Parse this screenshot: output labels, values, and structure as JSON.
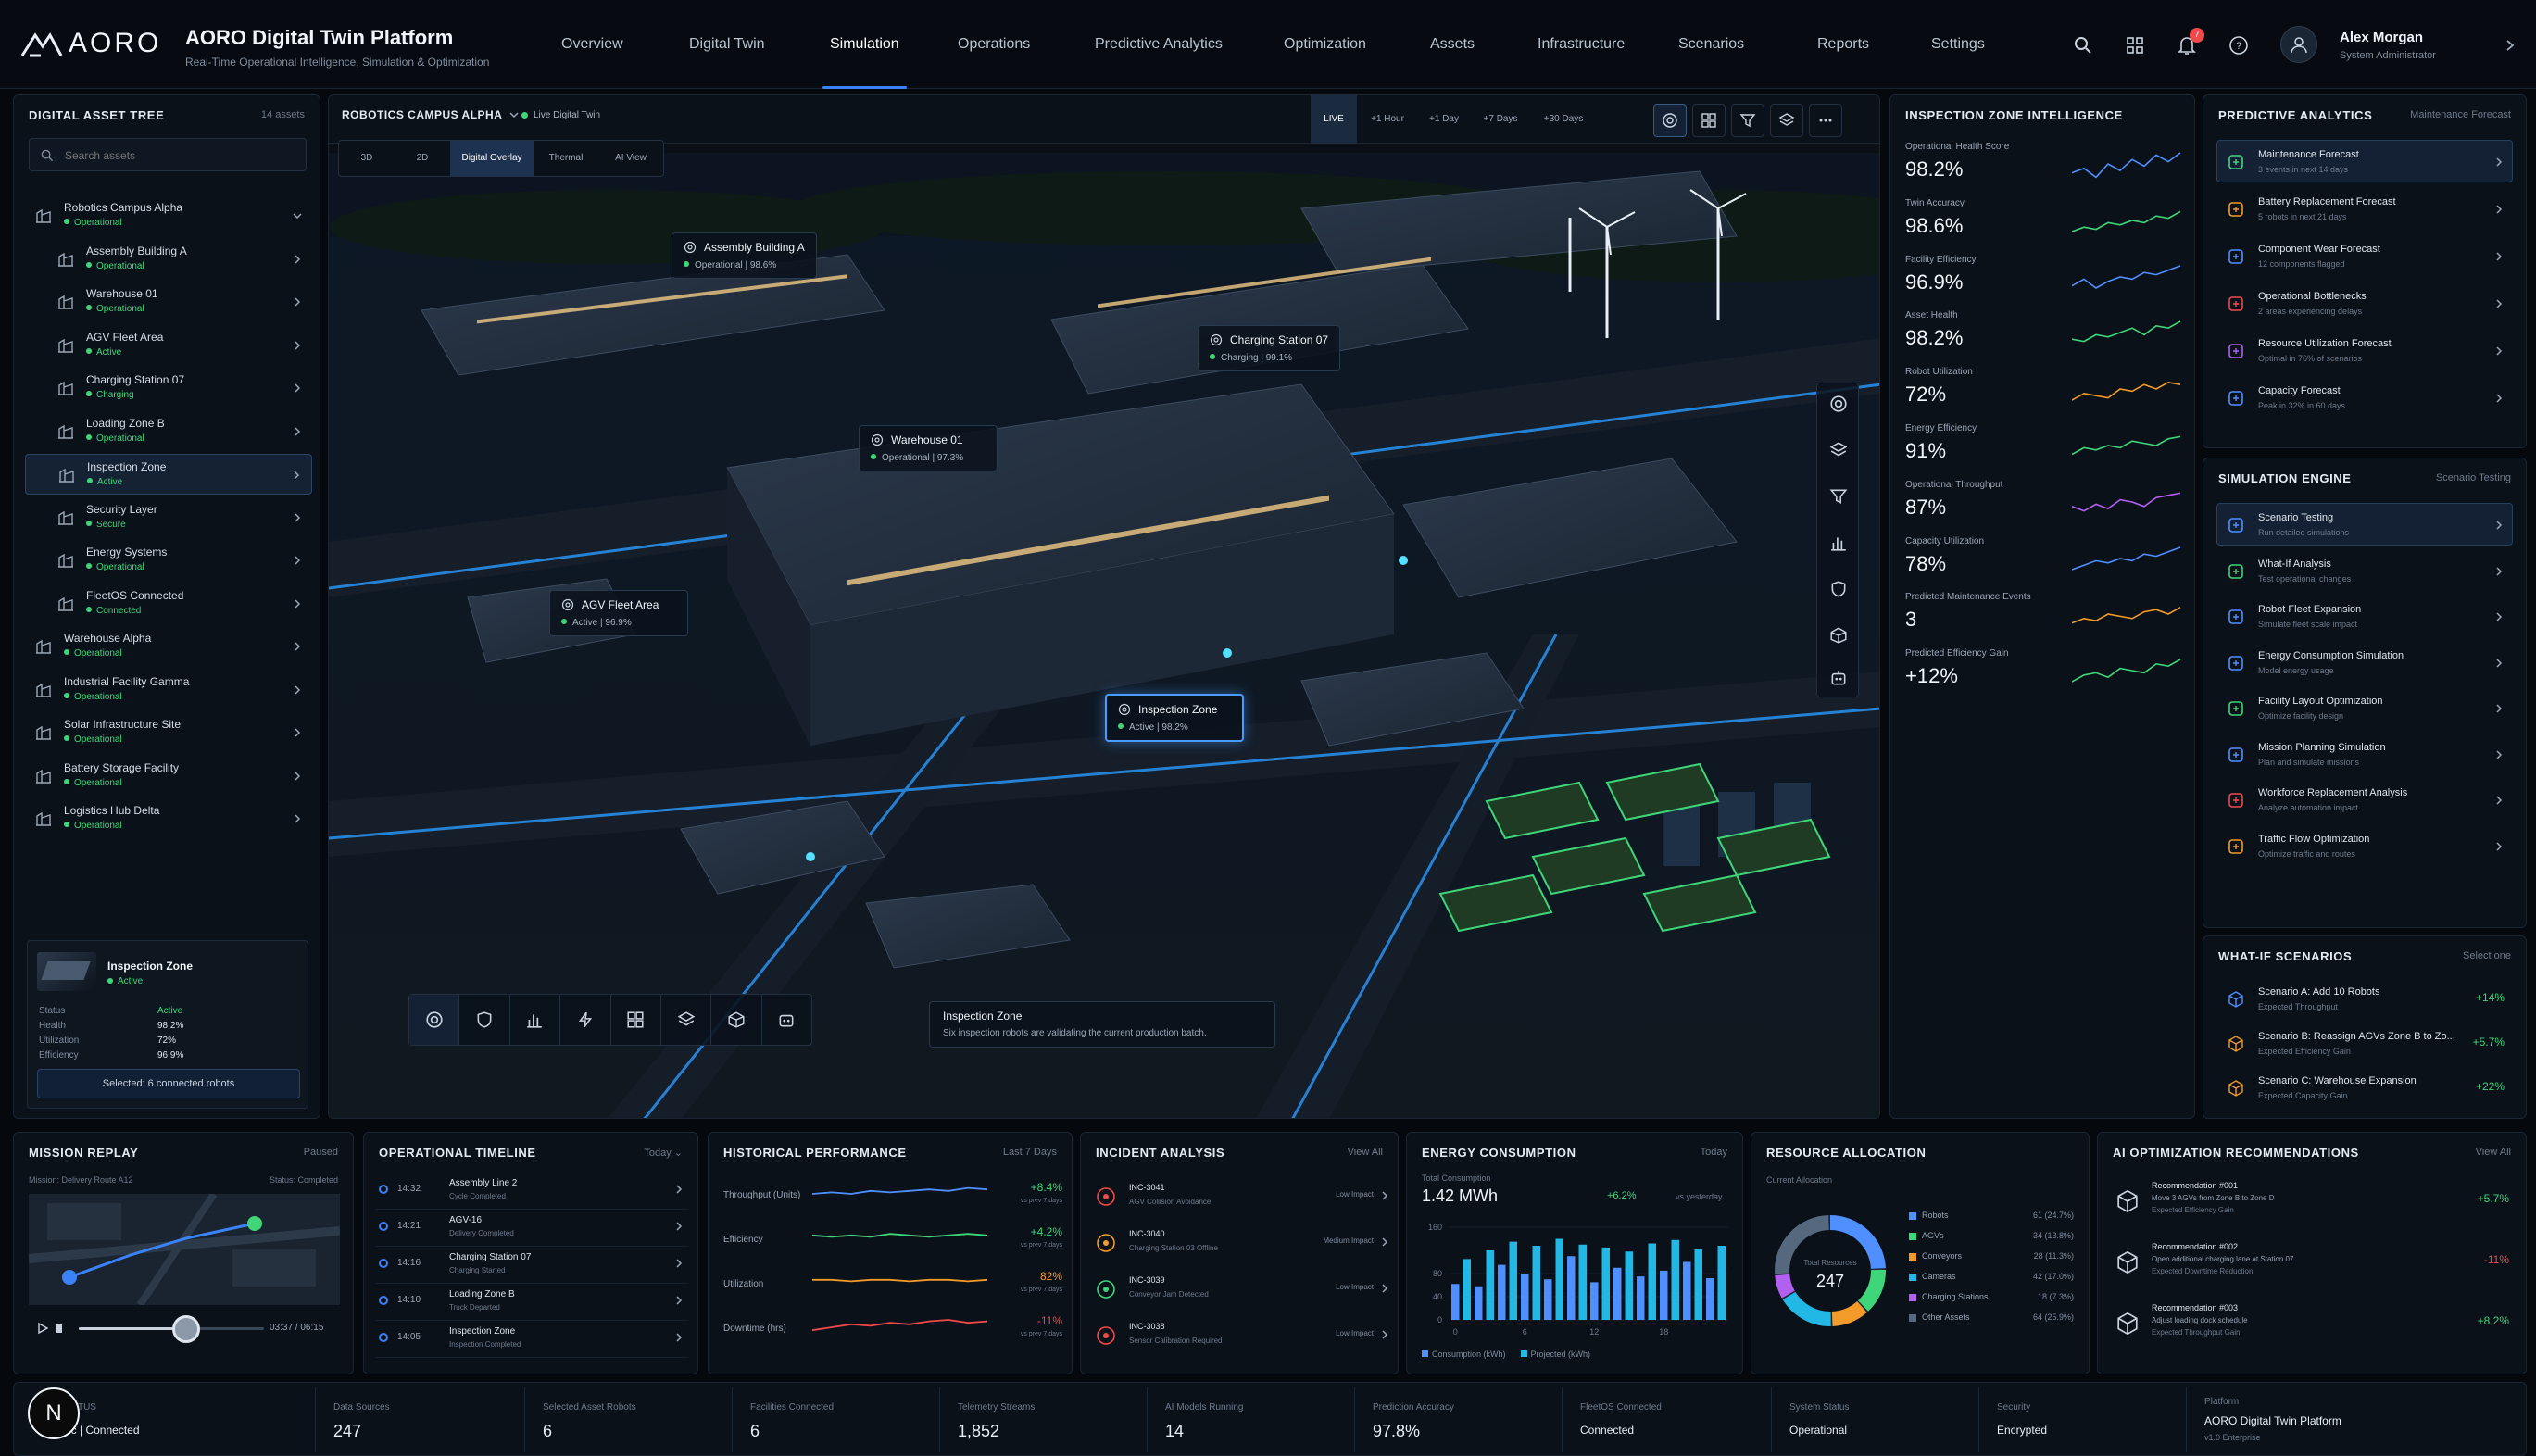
{
  "brand": {
    "logo_text": "AORO",
    "title": "AORO Digital Twin Platform",
    "subtitle": "Real-Time Operational Intelligence, Simulation & Optimization"
  },
  "nav": [
    "Overview",
    "Digital Twin",
    "Simulation",
    "Operations",
    "Predictive Analytics",
    "Optimization",
    "Assets",
    "Infrastructure",
    "Scenarios",
    "Reports",
    "Settings"
  ],
  "nav_active": "Simulation",
  "notif_count": "7",
  "user": {
    "name": "Alex Morgan",
    "role": "System Administrator"
  },
  "tree": {
    "title": "DIGITAL ASSET TREE",
    "count": "14 assets",
    "search_placeholder": "Search assets",
    "items": [
      {
        "name": "Robotics Campus Alpha",
        "status": "Operational",
        "level": 0,
        "open": true
      },
      {
        "name": "Assembly Building A",
        "status": "Operational",
        "level": 1
      },
      {
        "name": "Warehouse 01",
        "status": "Operational",
        "level": 1
      },
      {
        "name": "AGV Fleet Area",
        "status": "Active",
        "level": 1
      },
      {
        "name": "Charging Station 07",
        "status": "Charging",
        "level": 1
      },
      {
        "name": "Loading Zone B",
        "status": "Operational",
        "level": 1
      },
      {
        "name": "Inspection Zone",
        "status": "Active",
        "level": 1,
        "selected": true
      },
      {
        "name": "Security Layer",
        "status": "Secure",
        "level": 1
      },
      {
        "name": "Energy Systems",
        "status": "Operational",
        "level": 1
      },
      {
        "name": "FleetOS Connected",
        "status": "Connected",
        "level": 1
      },
      {
        "name": "Warehouse Alpha",
        "status": "Operational",
        "level": 0
      },
      {
        "name": "Industrial Facility Gamma",
        "status": "Operational",
        "level": 0
      },
      {
        "name": "Solar Infrastructure Site",
        "status": "Operational",
        "level": 0
      },
      {
        "name": "Battery Storage Facility",
        "status": "Operational",
        "level": 0
      },
      {
        "name": "Logistics Hub Delta",
        "status": "Operational",
        "level": 0
      }
    ],
    "detail": {
      "name": "Inspection Zone",
      "status": "Active",
      "rows": [
        [
          "Status",
          "Active"
        ],
        [
          "Health",
          "98.2%"
        ],
        [
          "Utilization",
          "72%"
        ],
        [
          "Efficiency",
          "96.9%"
        ]
      ],
      "button": "Selected: 6 connected robots"
    }
  },
  "scene": {
    "location": "ROBOTICS CAMPUS ALPHA",
    "live_label": "Live Digital Twin",
    "time_buttons": [
      "LIVE",
      "+1 Hour",
      "+1 Day",
      "+7 Days",
      "+30 Days"
    ],
    "view_tabs": [
      "3D",
      "2D",
      "Digital Overlay",
      "Thermal",
      "AI View"
    ],
    "view_active": "Digital Overlay",
    "tags": [
      {
        "name": "Assembly Building A",
        "info": "Operational | 98.6%"
      },
      {
        "name": "Charging Station 07",
        "info": "Charging | 99.1%"
      },
      {
        "name": "Warehouse 01",
        "info": "Operational | 97.3%"
      },
      {
        "name": "AGV Fleet Area",
        "info": "Active | 96.9%"
      },
      {
        "name": "Inspection Zone",
        "info": "Active | 98.2%"
      }
    ],
    "info_title": "Inspection Zone",
    "info_text": "Six inspection robots are validating the current production batch."
  },
  "intel": {
    "title": "INSPECTION ZONE INTELLIGENCE",
    "metrics": [
      {
        "label": "Operational Health Score",
        "value": "98.2%",
        "color": "#4f8fff"
      },
      {
        "label": "Twin Accuracy",
        "value": "98.6%",
        "color": "#3fd67a"
      },
      {
        "label": "Facility Efficiency",
        "value": "96.9%",
        "color": "#4f8fff"
      },
      {
        "label": "Asset Health",
        "value": "98.2%",
        "color": "#3fd67a"
      },
      {
        "label": "Robot Utilization",
        "value": "72%",
        "color": "#f29b2b"
      },
      {
        "label": "Energy Efficiency",
        "value": "91%",
        "color": "#3fd67a"
      },
      {
        "label": "Operational Throughput",
        "value": "87%",
        "color": "#b160f0"
      },
      {
        "label": "Capacity Utilization",
        "value": "78%",
        "color": "#4f8fff"
      },
      {
        "label": "Predicted Maintenance Events",
        "value": "3",
        "color": "#f29b2b"
      },
      {
        "label": "Predicted Efficiency Gain",
        "value": "+12%",
        "color": "#3fd67a"
      }
    ]
  },
  "predictive": {
    "title": "PREDICTIVE ANALYTICS",
    "action": "Maintenance Forecast",
    "items": [
      {
        "title": "Maintenance Forecast",
        "sub": "3 events in next 14 days",
        "color": "#3fd67a"
      },
      {
        "title": "Battery Replacement Forecast",
        "sub": "5 robots in next 21 days",
        "color": "#f29b2b"
      },
      {
        "title": "Component Wear Forecast",
        "sub": "12 components flagged",
        "color": "#4f8fff"
      },
      {
        "title": "Operational Bottlenecks",
        "sub": "2 areas experiencing delays",
        "color": "#ef4a4a"
      },
      {
        "title": "Resource Utilization Forecast",
        "sub": "Optimal in 76% of scenarios",
        "color": "#b160f0"
      },
      {
        "title": "Capacity Forecast",
        "sub": "Peak in 32% in 60 days",
        "color": "#4f8fff"
      }
    ]
  },
  "sim": {
    "title": "SIMULATION ENGINE",
    "action": "Scenario Testing",
    "items": [
      {
        "title": "Scenario Testing",
        "sub": "Run detailed simulations",
        "color": "#4f8fff"
      },
      {
        "title": "What-If Analysis",
        "sub": "Test operational changes",
        "color": "#3fd67a"
      },
      {
        "title": "Robot Fleet Expansion",
        "sub": "Simulate fleet scale impact",
        "color": "#4f8fff"
      },
      {
        "title": "Energy Consumption Simulation",
        "sub": "Model energy usage",
        "color": "#4f8fff"
      },
      {
        "title": "Facility Layout Optimization",
        "sub": "Optimize facility design",
        "color": "#3fd67a"
      },
      {
        "title": "Mission Planning Simulation",
        "sub": "Plan and simulate missions",
        "color": "#4f8fff"
      },
      {
        "title": "Workforce Replacement Analysis",
        "sub": "Analyze automation impact",
        "color": "#ef4a4a"
      },
      {
        "title": "Traffic Flow Optimization",
        "sub": "Optimize traffic and routes",
        "color": "#f29b2b"
      }
    ]
  },
  "whatif": {
    "title": "WHAT-IF SCENARIOS",
    "action": "Select one",
    "items": [
      {
        "title": "Scenario A: Add 10 Robots",
        "sub": "Expected Throughput",
        "value": "+14%",
        "color": "#4f8fff"
      },
      {
        "title": "Scenario B: Reassign AGVs Zone B to Zo...",
        "sub": "Expected Efficiency Gain",
        "value": "+5.7%",
        "color": "#f29b2b"
      },
      {
        "title": "Scenario C: Warehouse Expansion",
        "sub": "Expected Capacity Gain",
        "value": "+22%",
        "color": "#f29b2b"
      }
    ]
  },
  "replay": {
    "title": "MISSION REPLAY",
    "state": "Paused",
    "mission": "Mission: Delivery Route A12",
    "status": "Status: Completed",
    "time": "03:37 / 06:15",
    "progress": 0.58
  },
  "timeline": {
    "title": "OPERATIONAL TIMELINE",
    "action": "Today",
    "items": [
      {
        "time": "14:32",
        "title": "Assembly Line 2",
        "sub": "Cycle Completed"
      },
      {
        "time": "14:21",
        "title": "AGV-16",
        "sub": "Delivery Completed"
      },
      {
        "time": "14:16",
        "title": "Charging Station 07",
        "sub": "Charging Started"
      },
      {
        "time": "14:10",
        "title": "Loading Zone B",
        "sub": "Truck Departed"
      },
      {
        "time": "14:05",
        "title": "Inspection Zone",
        "sub": "Inspection Completed"
      }
    ]
  },
  "history": {
    "title": "HISTORICAL PERFORMANCE",
    "action": "Last 7 Days",
    "rows": [
      {
        "label": "Throughput (Units)",
        "value": "+8.4%",
        "note": "vs prev 7 days",
        "color": "#4f8fff",
        "cls": "green"
      },
      {
        "label": "Efficiency",
        "value": "+4.2%",
        "note": "vs prev 7 days",
        "color": "#3fd67a",
        "cls": "green"
      },
      {
        "label": "Utilization",
        "value": "82%",
        "note": "vs prev 7 days",
        "color": "#f29b2b",
        "cls": "orange"
      },
      {
        "label": "Downtime (hrs)",
        "value": "-11%",
        "note": "vs prev 7 days",
        "color": "#ef4a4a",
        "cls": "red"
      }
    ]
  },
  "incidents": {
    "title": "INCIDENT ANALYSIS",
    "action": "View All",
    "items": [
      {
        "id": "INC-3041",
        "desc": "AGV Collision Avoidance",
        "impact": "Low Impact",
        "color": "#ef4a4a"
      },
      {
        "id": "INC-3040",
        "desc": "Charging Station 03 Offline",
        "impact": "Medium Impact",
        "color": "#f29b2b"
      },
      {
        "id": "INC-3039",
        "desc": "Conveyor Jam Detected",
        "impact": "Low Impact",
        "color": "#3fd67a"
      },
      {
        "id": "INC-3038",
        "desc": "Sensor Calibration Required",
        "impact": "Low Impact",
        "color": "#ef4a4a"
      }
    ]
  },
  "energy": {
    "title": "ENERGY CONSUMPTION",
    "action": "Today",
    "label": "Total Consumption",
    "value": "1.42 MWh",
    "change": "+6.2%",
    "vs": "vs yesterday",
    "legend": [
      "Consumption (kWh)",
      "Projected (kWh)"
    ]
  },
  "chart_data": {
    "type": "bar",
    "x": [
      0,
      1,
      2,
      3,
      4,
      5,
      6,
      7,
      8,
      9,
      10,
      11,
      12,
      13,
      14,
      15,
      16,
      17,
      18,
      19,
      20,
      21,
      22,
      23
    ],
    "values": [
      62,
      105,
      58,
      120,
      95,
      135,
      80,
      128,
      70,
      140,
      110,
      130,
      65,
      125,
      90,
      118,
      75,
      132,
      85,
      138,
      100,
      122,
      72,
      128
    ],
    "xticks": [
      "0",
      "6",
      "12",
      "18"
    ],
    "yticks": [
      "160",
      "80",
      "40",
      "0"
    ],
    "ylim": [
      0,
      160
    ]
  },
  "resources": {
    "title": "RESOURCE ALLOCATION",
    "sub": "Current Allocation",
    "total_label": "Total Resources",
    "total": "247",
    "items": [
      {
        "name": "Robots",
        "value": "61 (24.7%)",
        "color": "#4f8fff",
        "frac": 0.247
      },
      {
        "name": "AGVs",
        "value": "34 (13.8%)",
        "color": "#3fd67a",
        "frac": 0.138
      },
      {
        "name": "Conveyors",
        "value": "28 (11.3%)",
        "color": "#f29b2b",
        "frac": 0.113
      },
      {
        "name": "Cameras",
        "value": "42 (17.0%)",
        "color": "#22b8e6",
        "frac": 0.17
      },
      {
        "name": "Charging Stations",
        "value": "18 (7.3%)",
        "color": "#b160f0",
        "frac": 0.073
      },
      {
        "name": "Other Assets",
        "value": "64 (25.9%)",
        "color": "#55687d",
        "frac": 0.259
      }
    ]
  },
  "ai": {
    "title": "AI OPTIMIZATION RECOMMENDATIONS",
    "action": "View All",
    "items": [
      {
        "title": "Recommendation #001",
        "desc": "Move 3 AGVs from Zone B to Zone D",
        "sub": "Expected Efficiency Gain",
        "value": "+5.7%",
        "cls": "green"
      },
      {
        "title": "Recommendation #002",
        "desc": "Open additional charging lane at Station 07",
        "sub": "Expected Downtime Reduction",
        "value": "-11%",
        "cls": "red"
      },
      {
        "title": "Recommendation #003",
        "desc": "Adjust loading dock schedule",
        "sub": "Expected Throughput Gain",
        "value": "+8.2%",
        "cls": "green"
      }
    ]
  },
  "status": [
    {
      "label": "N STATUS",
      "value": "Sync | Connected",
      "cls": "green"
    },
    {
      "label": "Data Sources",
      "value": "247"
    },
    {
      "label": "Selected Asset Robots",
      "value": "6"
    },
    {
      "label": "Facilities Connected",
      "value": "6"
    },
    {
      "label": "Telemetry Streams",
      "value": "1,852"
    },
    {
      "label": "AI Models Running",
      "value": "14"
    },
    {
      "label": "Prediction Accuracy",
      "value": "97.8%"
    },
    {
      "label": "FleetOS Connected",
      "value": "Connected",
      "cls": "green"
    },
    {
      "label": "System Status",
      "value": "Operational",
      "cls": "green"
    },
    {
      "label": "Security",
      "value": "Encrypted",
      "cls": "green"
    }
  ],
  "platform": {
    "label": "Platform",
    "name": "AORO Digital Twin Platform",
    "version": "v1.0 Enterprise"
  },
  "badge_letter": "N"
}
